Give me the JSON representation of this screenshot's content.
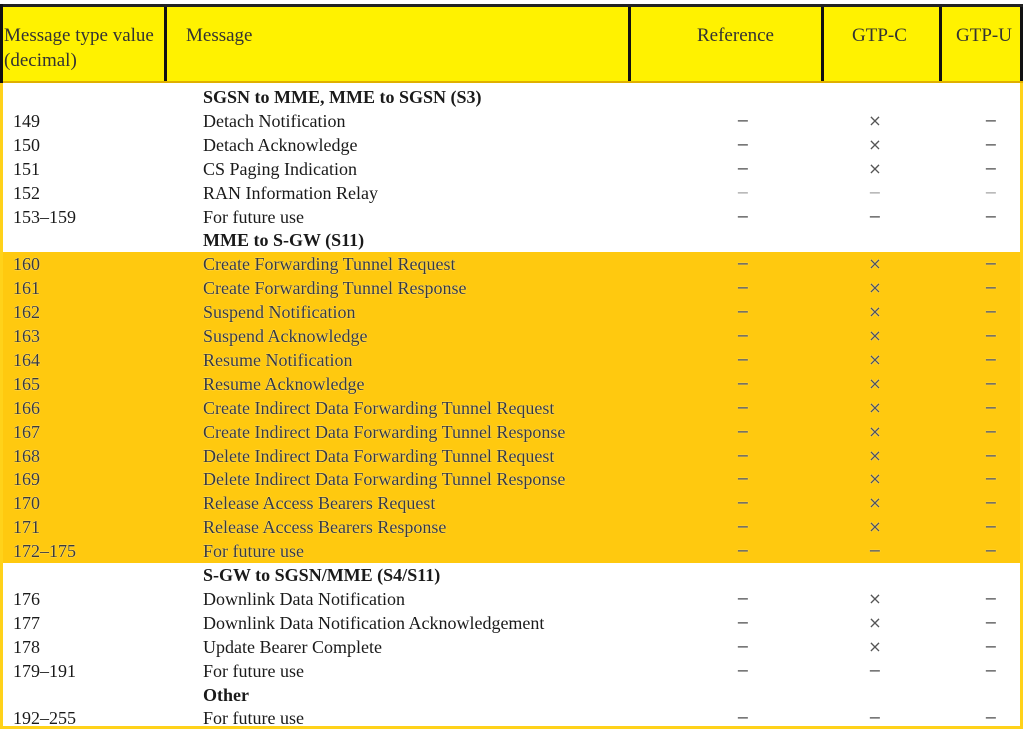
{
  "header": {
    "type_value": "Message type value (decimal)",
    "message": "Message",
    "reference": "Reference",
    "gtp_c": "GTP-C",
    "gtp_u": "GTP-U"
  },
  "symbols": {
    "yes": "×",
    "no": "−"
  },
  "colors": {
    "header_bg": "#fff200",
    "highlight_bg": "#ffc90f",
    "border": "#ffd21a"
  },
  "rows": [
    {
      "kind": "section",
      "message": "SGSN to MME, MME to SGSN (S3)"
    },
    {
      "kind": "entry",
      "value": "149",
      "message": "Detach Notification",
      "reference": "−",
      "gtp_c": "×",
      "gtp_u": "−"
    },
    {
      "kind": "entry",
      "value": "150",
      "message": "Detach Acknowledge",
      "reference": "−",
      "gtp_c": "×",
      "gtp_u": "−"
    },
    {
      "kind": "entry",
      "value": "151",
      "message": "CS Paging Indication",
      "reference": "−",
      "gtp_c": "×",
      "gtp_u": "−"
    },
    {
      "kind": "entry",
      "value": "152",
      "message": "RAN Information Relay",
      "reference": "−",
      "gtp_c": "−",
      "gtp_u": "−",
      "faint": true
    },
    {
      "kind": "entry",
      "value": "153–159",
      "message": "For future use",
      "reference": "−",
      "gtp_c": "−",
      "gtp_u": "−"
    },
    {
      "kind": "section",
      "message": "MME to S-GW (S11)"
    },
    {
      "kind": "entry",
      "hl": true,
      "value": "160",
      "message": "Create Forwarding Tunnel Request",
      "reference": "−",
      "gtp_c": "×",
      "gtp_u": "−"
    },
    {
      "kind": "entry",
      "hl": true,
      "value": "161",
      "message": "Create Forwarding Tunnel Response",
      "reference": "−",
      "gtp_c": "×",
      "gtp_u": "−"
    },
    {
      "kind": "entry",
      "hl": true,
      "value": "162",
      "message": "Suspend Notification",
      "reference": "−",
      "gtp_c": "×",
      "gtp_u": "−"
    },
    {
      "kind": "entry",
      "hl": true,
      "value": "163",
      "message": "Suspend Acknowledge",
      "reference": "−",
      "gtp_c": "×",
      "gtp_u": "−"
    },
    {
      "kind": "entry",
      "hl": true,
      "value": "164",
      "message": "Resume Notification",
      "reference": "−",
      "gtp_c": "×",
      "gtp_u": "−"
    },
    {
      "kind": "entry",
      "hl": true,
      "value": "165",
      "message": "Resume Acknowledge",
      "reference": "−",
      "gtp_c": "×",
      "gtp_u": "−"
    },
    {
      "kind": "entry",
      "hl": true,
      "value": "166",
      "message": "Create Indirect Data Forwarding Tunnel Request",
      "reference": "−",
      "gtp_c": "×",
      "gtp_u": "−"
    },
    {
      "kind": "entry",
      "hl": true,
      "value": "167",
      "message": "Create Indirect Data Forwarding Tunnel Response",
      "reference": "−",
      "gtp_c": "×",
      "gtp_u": "−"
    },
    {
      "kind": "entry",
      "hl": true,
      "value": "168",
      "message": "Delete Indirect Data Forwarding Tunnel Request",
      "reference": "−",
      "gtp_c": "×",
      "gtp_u": "−"
    },
    {
      "kind": "entry",
      "hl": true,
      "value": "169",
      "message": "Delete Indirect Data Forwarding Tunnel Response",
      "reference": "−",
      "gtp_c": "×",
      "gtp_u": "−"
    },
    {
      "kind": "entry",
      "hl": true,
      "value": "170",
      "message": "Release Access Bearers Request",
      "reference": "−",
      "gtp_c": "×",
      "gtp_u": "−"
    },
    {
      "kind": "entry",
      "hl": true,
      "value": "171",
      "message": "Release Access Bearers Response",
      "reference": "−",
      "gtp_c": "×",
      "gtp_u": "−"
    },
    {
      "kind": "entry",
      "hl": true,
      "value": "172–175",
      "message": "For future use",
      "reference": "−",
      "gtp_c": "−",
      "gtp_u": "−"
    },
    {
      "kind": "section",
      "message": "S-GW to SGSN/MME (S4/S11)"
    },
    {
      "kind": "entry",
      "value": "176",
      "message": "Downlink Data Notification",
      "reference": "−",
      "gtp_c": "×",
      "gtp_u": "−"
    },
    {
      "kind": "entry",
      "value": "177",
      "message": "Downlink Data Notification Acknowledgement",
      "reference": "−",
      "gtp_c": "×",
      "gtp_u": "−"
    },
    {
      "kind": "entry",
      "value": "178",
      "message": "Update Bearer Complete",
      "reference": "−",
      "gtp_c": "×",
      "gtp_u": "−"
    },
    {
      "kind": "entry",
      "value": "179–191",
      "message": "For future use",
      "reference": "−",
      "gtp_c": "−",
      "gtp_u": "−"
    },
    {
      "kind": "section",
      "message": "Other"
    },
    {
      "kind": "entry",
      "value": "192–255",
      "message": "For future use",
      "reference": "−",
      "gtp_c": "−",
      "gtp_u": "−"
    }
  ]
}
